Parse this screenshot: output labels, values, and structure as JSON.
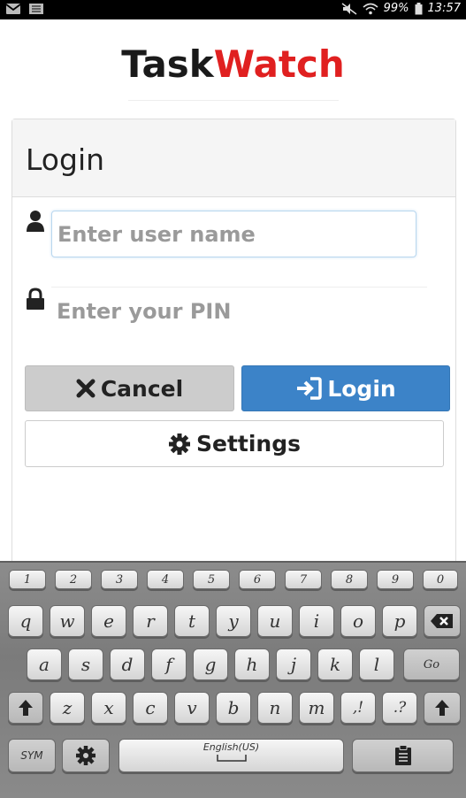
{
  "status_bar": {
    "battery": "99%",
    "time": "13:57",
    "icons": [
      "gmail-icon",
      "notes-icon",
      "mute-icon",
      "wifi-icon",
      "battery-icon"
    ]
  },
  "brand": {
    "part1": "Task",
    "part2": "Watch",
    "color_part1": "#1a1a1a",
    "color_part2": "#e02020"
  },
  "login": {
    "title": "Login",
    "username_placeholder": "Enter user name",
    "pin_placeholder": "Enter your PIN",
    "cancel_label": "Cancel",
    "login_label": "Login",
    "settings_label": "Settings",
    "accent_color": "#3c83c8"
  },
  "keyboard": {
    "numbers": [
      "1",
      "2",
      "3",
      "4",
      "5",
      "6",
      "7",
      "8",
      "9",
      "0"
    ],
    "row1": [
      "q",
      "w",
      "e",
      "r",
      "t",
      "y",
      "u",
      "i",
      "o",
      "p"
    ],
    "row2": [
      "a",
      "s",
      "d",
      "f",
      "g",
      "h",
      "j",
      "k",
      "l"
    ],
    "row3": [
      "z",
      "x",
      "c",
      "v",
      "b",
      "n",
      "m"
    ],
    "comma_key": ",!",
    "period_key": ".?",
    "go_label": "Go",
    "sym_label": "SYM",
    "space_label": "English(US)"
  }
}
